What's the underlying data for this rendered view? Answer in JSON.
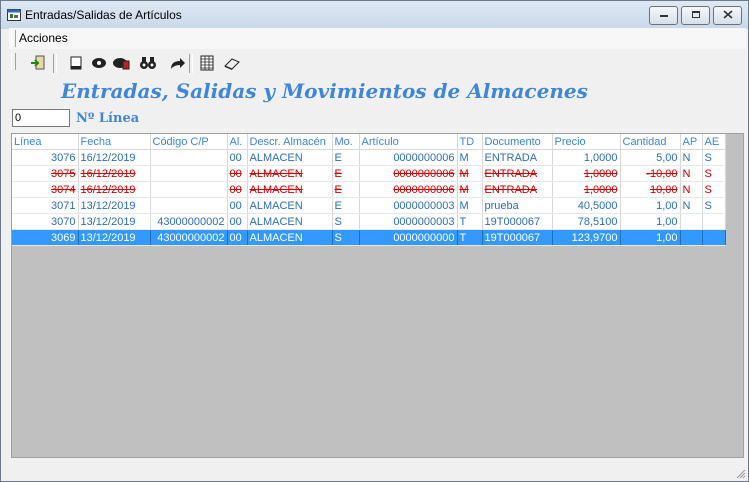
{
  "window": {
    "title": "Entradas/Salidas de Artículos",
    "minimize_icon": "minimize-icon",
    "maximize_icon": "maximize-icon",
    "close_icon": "close-icon"
  },
  "menu": {
    "acciones_label": "Acciones"
  },
  "toolbar": {
    "buttons": [
      "exit-icon",
      "new-document-icon",
      "eye-icon",
      "view-details-icon",
      "binoculars-icon",
      "forward-arrow-icon",
      "grid-icon",
      "eraser-icon"
    ]
  },
  "heading": "Entradas, Salidas y Movimientos de Almacenes",
  "linea_filter": {
    "value": "0",
    "label": "Nº Línea"
  },
  "table": {
    "columns": [
      "Línea",
      "Fecha",
      "Código C/P",
      "Al.",
      "Descr. Almacén",
      "Mo.",
      "Artículo",
      "TD",
      "Documento",
      "Precio",
      "Cantidad",
      "AP",
      "AE"
    ],
    "rows": [
      {
        "linea": "3076",
        "fecha": "16/12/2019",
        "codigo": "",
        "al": "00",
        "descr": "ALMACEN",
        "mo": "E",
        "articulo": "0000000006",
        "td": "M",
        "documento": "ENTRADA",
        "precio": "1,0000",
        "cantidad": "5,00",
        "ap": "N",
        "ae": "S",
        "state": "normal"
      },
      {
        "linea": "3075",
        "fecha": "16/12/2019",
        "codigo": "",
        "al": "00",
        "descr": "ALMACEN",
        "mo": "E",
        "articulo": "0000000006",
        "td": "M",
        "documento": "ENTRADA",
        "precio": "1,0000",
        "cantidad": "-10,00",
        "ap": "N",
        "ae": "S",
        "state": "deleted"
      },
      {
        "linea": "3074",
        "fecha": "16/12/2019",
        "codigo": "",
        "al": "00",
        "descr": "ALMACEN",
        "mo": "E",
        "articulo": "0000000006",
        "td": "M",
        "documento": "ENTRADA",
        "precio": "1,0000",
        "cantidad": "10,00",
        "ap": "N",
        "ae": "S",
        "state": "deleted"
      },
      {
        "linea": "3071",
        "fecha": "13/12/2019",
        "codigo": "",
        "al": "00",
        "descr": "ALMACEN",
        "mo": "E",
        "articulo": "0000000003",
        "td": "M",
        "documento": "prueba",
        "precio": "40,5000",
        "cantidad": "1,00",
        "ap": "N",
        "ae": "S",
        "state": "normal"
      },
      {
        "linea": "3070",
        "fecha": "13/12/2019",
        "codigo": "43000000002",
        "al": "00",
        "descr": "ALMACEN",
        "mo": "S",
        "articulo": "0000000003",
        "td": "T",
        "documento": "19T000067",
        "precio": "78,5100",
        "cantidad": "1,00",
        "ap": "",
        "ae": "",
        "state": "normal"
      },
      {
        "linea": "3069",
        "fecha": "13/12/2019",
        "codigo": "43000000002",
        "al": "00",
        "descr": "ALMACEN",
        "mo": "S",
        "articulo": "0000000000",
        "td": "T",
        "documento": "19T000067",
        "precio": "123,9700",
        "cantidad": "1,00",
        "ap": "",
        "ae": "",
        "state": "selected"
      }
    ]
  },
  "colors": {
    "accent": "#3f86d6",
    "deleted": "#cc0000",
    "selected": "#3399ff",
    "grid_empty": "#c0c0c0"
  }
}
